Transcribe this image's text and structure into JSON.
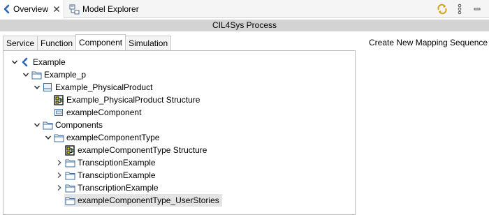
{
  "viewbar": {
    "tabs": [
      {
        "label": "Overview",
        "icon": "cil4sys-chevron-icon",
        "active": true,
        "closable": true
      },
      {
        "label": "Model Explorer",
        "icon": "model-explorer-icon",
        "active": false,
        "closable": false
      }
    ],
    "toolbar": [
      "sync-icon",
      "more-vertical-icon",
      "minimize-icon"
    ]
  },
  "title": "CIL4Sys Process",
  "inner_tabs": [
    {
      "label": "Service",
      "active": false
    },
    {
      "label": "Function",
      "active": false
    },
    {
      "label": "Component",
      "active": true
    },
    {
      "label": "Simulation",
      "active": false
    }
  ],
  "tree": [
    {
      "label": "Example",
      "level": 0,
      "expander": "expanded",
      "icon": "cil4sys-chevron-icon",
      "selected": false
    },
    {
      "label": "Example_p",
      "level": 1,
      "expander": "expanded",
      "icon": "folder-icon",
      "selected": false
    },
    {
      "label": "Example_PhysicalProduct",
      "level": 2,
      "expander": "expanded",
      "icon": "product-icon",
      "selected": false
    },
    {
      "label": "Example_PhysicalProduct Structure",
      "level": 3,
      "expander": "none",
      "icon": "structure-icon",
      "selected": false
    },
    {
      "label": "exampleComponent",
      "level": 3,
      "expander": "none",
      "icon": "component-icon",
      "selected": false
    },
    {
      "label": "Components",
      "level": 2,
      "expander": "expanded",
      "icon": "folder-icon",
      "selected": false
    },
    {
      "label": "exampleComponentType",
      "level": 3,
      "expander": "expanded",
      "icon": "folder-icon",
      "selected": false
    },
    {
      "label": "exampleComponentType Structure",
      "level": 4,
      "expander": "none",
      "icon": "structure-icon",
      "selected": false
    },
    {
      "label": "TransciptionExample",
      "level": 4,
      "expander": "collapsed",
      "icon": "folder-icon",
      "selected": false
    },
    {
      "label": "TransciptionExample",
      "level": 4,
      "expander": "collapsed",
      "icon": "folder-icon",
      "selected": false
    },
    {
      "label": "TranscriptionExample",
      "level": 4,
      "expander": "collapsed",
      "icon": "folder-icon",
      "selected": false
    },
    {
      "label": "exampleComponentType_UserStories",
      "level": 4,
      "expander": "none",
      "icon": "folder-icon",
      "selected": true
    }
  ],
  "right_panel": {
    "title": "Create New Mapping Sequence"
  }
}
